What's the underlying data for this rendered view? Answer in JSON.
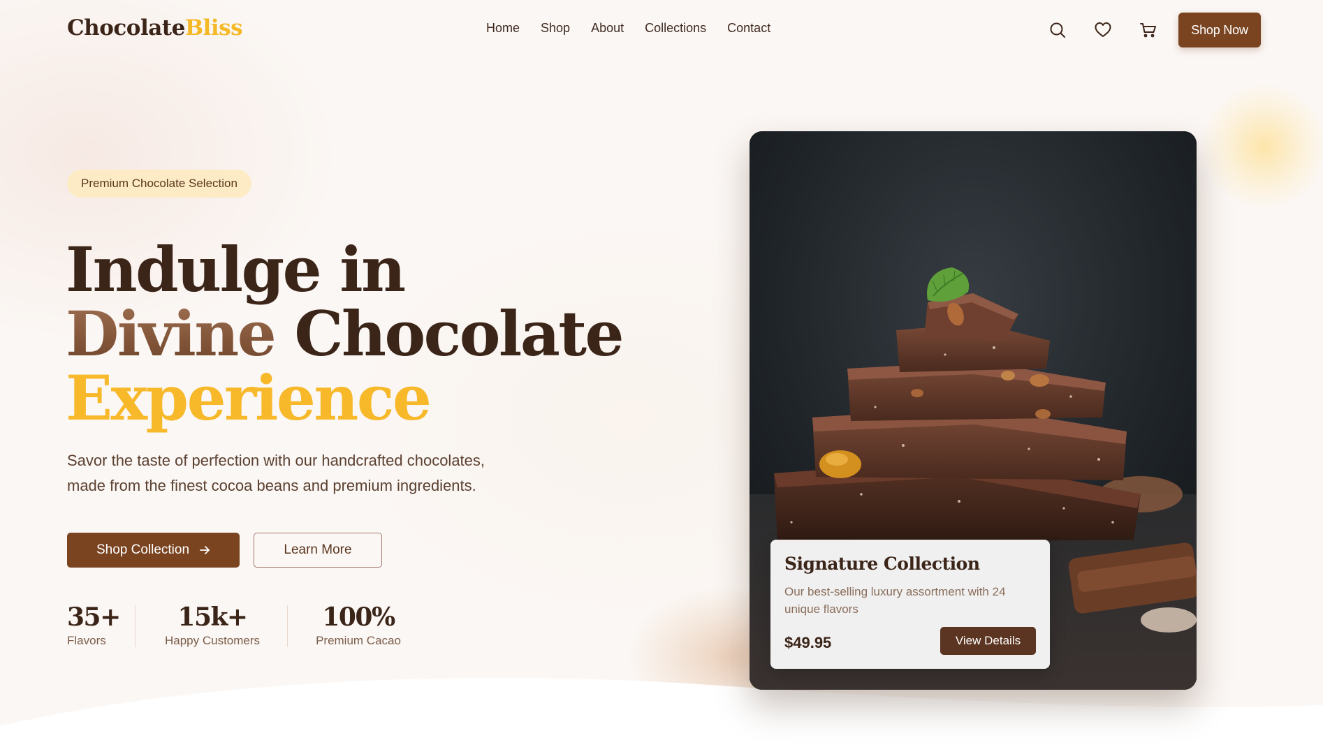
{
  "brand": {
    "name_part1": "Chocolate",
    "name_part2": "Bliss"
  },
  "nav": {
    "links": [
      "Home",
      "Shop",
      "About",
      "Collections",
      "Contact"
    ],
    "icons": [
      "search-icon",
      "heart-icon",
      "cart-icon"
    ],
    "cta_label": "Shop Now"
  },
  "hero": {
    "badge": "Premium Chocolate Selection",
    "title_line1": "Indulge in",
    "title_line2a": "Divine",
    "title_line2b": "Chocolate",
    "title_line3": "Experience",
    "description_line1": "Savor the taste of perfection with our handcrafted chocolates,",
    "description_line2": "made from the finest cocoa beans and premium ingredients.",
    "primary_button": "Shop Collection",
    "secondary_button": "Learn More",
    "stats": [
      {
        "value": "35+",
        "label": "Flavors"
      },
      {
        "value": "15k+",
        "label": "Happy Customers"
      },
      {
        "value": "100%",
        "label": "Premium Cacao"
      }
    ]
  },
  "product_card": {
    "title": "Signature Collection",
    "description": "Our best-selling luxury assortment with 24 unique flavors",
    "price": "$49.95",
    "button": "View Details"
  },
  "colors": {
    "brand_brown": "#7a4420",
    "accent_gold": "#f5b928",
    "dark_text": "#3b2418",
    "badge_bg": "#fcebc4",
    "page_bg": "#fbf7f4"
  }
}
